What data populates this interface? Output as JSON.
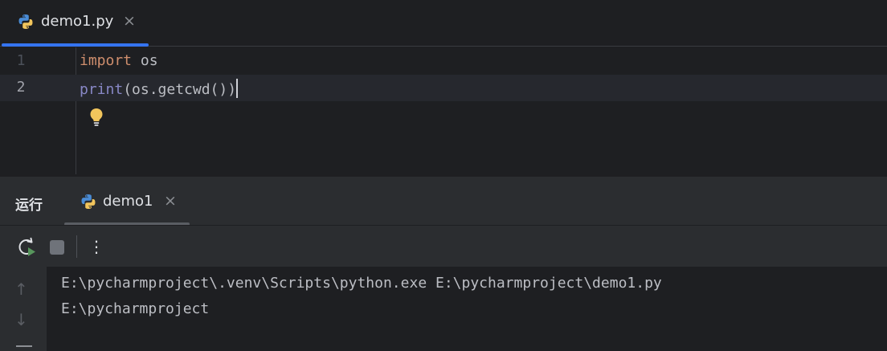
{
  "editor_tab": {
    "filename": "demo1.py",
    "close_glyph": "×",
    "icon": "python-icon"
  },
  "editor": {
    "lines": [
      {
        "number": "1",
        "kw": "import",
        "rest": " os"
      },
      {
        "number": "2",
        "fn": "print",
        "rest": "(os.getcwd())"
      }
    ],
    "hint_icon": "lightbulb-icon"
  },
  "run_panel": {
    "title": "运行",
    "tab": {
      "label": "demo1",
      "close_glyph": "×",
      "icon": "python-icon"
    },
    "toolbar": {
      "more_glyph": "⋮"
    },
    "side": {
      "up_glyph": "↑",
      "down_glyph": "↓"
    },
    "output": [
      "E:\\pycharmproject\\.venv\\Scripts\\python.exe E:\\pycharmproject\\demo1.py",
      "E:\\pycharmproject"
    ]
  },
  "colors": {
    "accent": "#3574f0",
    "keyword": "#cf8e6d",
    "builtin": "#8888c6",
    "text": "#bcbec4",
    "bulb": "#f2c55c"
  }
}
